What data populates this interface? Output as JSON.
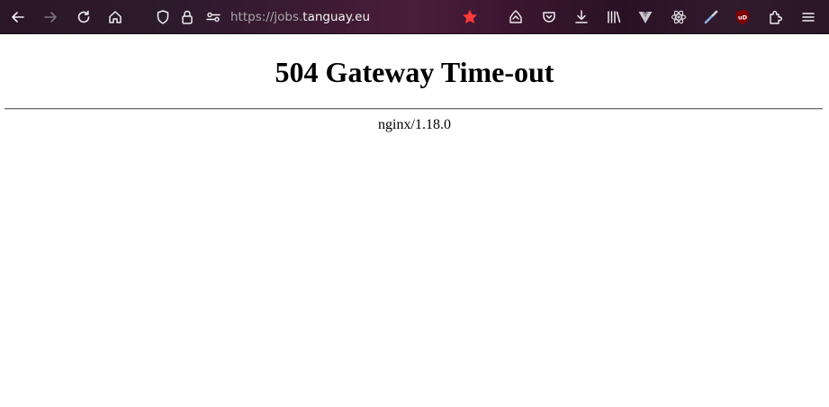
{
  "browser": {
    "url_protocol": "https://jobs.",
    "url_host": "tanguay.eu",
    "accent_star_color": "#ff3a3a",
    "icons": [
      "back-icon",
      "forward-icon",
      "reload-icon",
      "home-icon",
      "shield-icon",
      "lock-icon",
      "permissions-icon",
      "bookmark-star-icon",
      "reader-mode-icon",
      "pocket-icon",
      "downloads-icon",
      "library-icon",
      "vue-devtools-icon",
      "react-devtools-icon",
      "color-picker-icon",
      "ublock-origin-icon",
      "extensions-icon",
      "menu-icon"
    ]
  },
  "page": {
    "title": "504 Gateway Time-out",
    "server": "nginx/1.18.0"
  }
}
